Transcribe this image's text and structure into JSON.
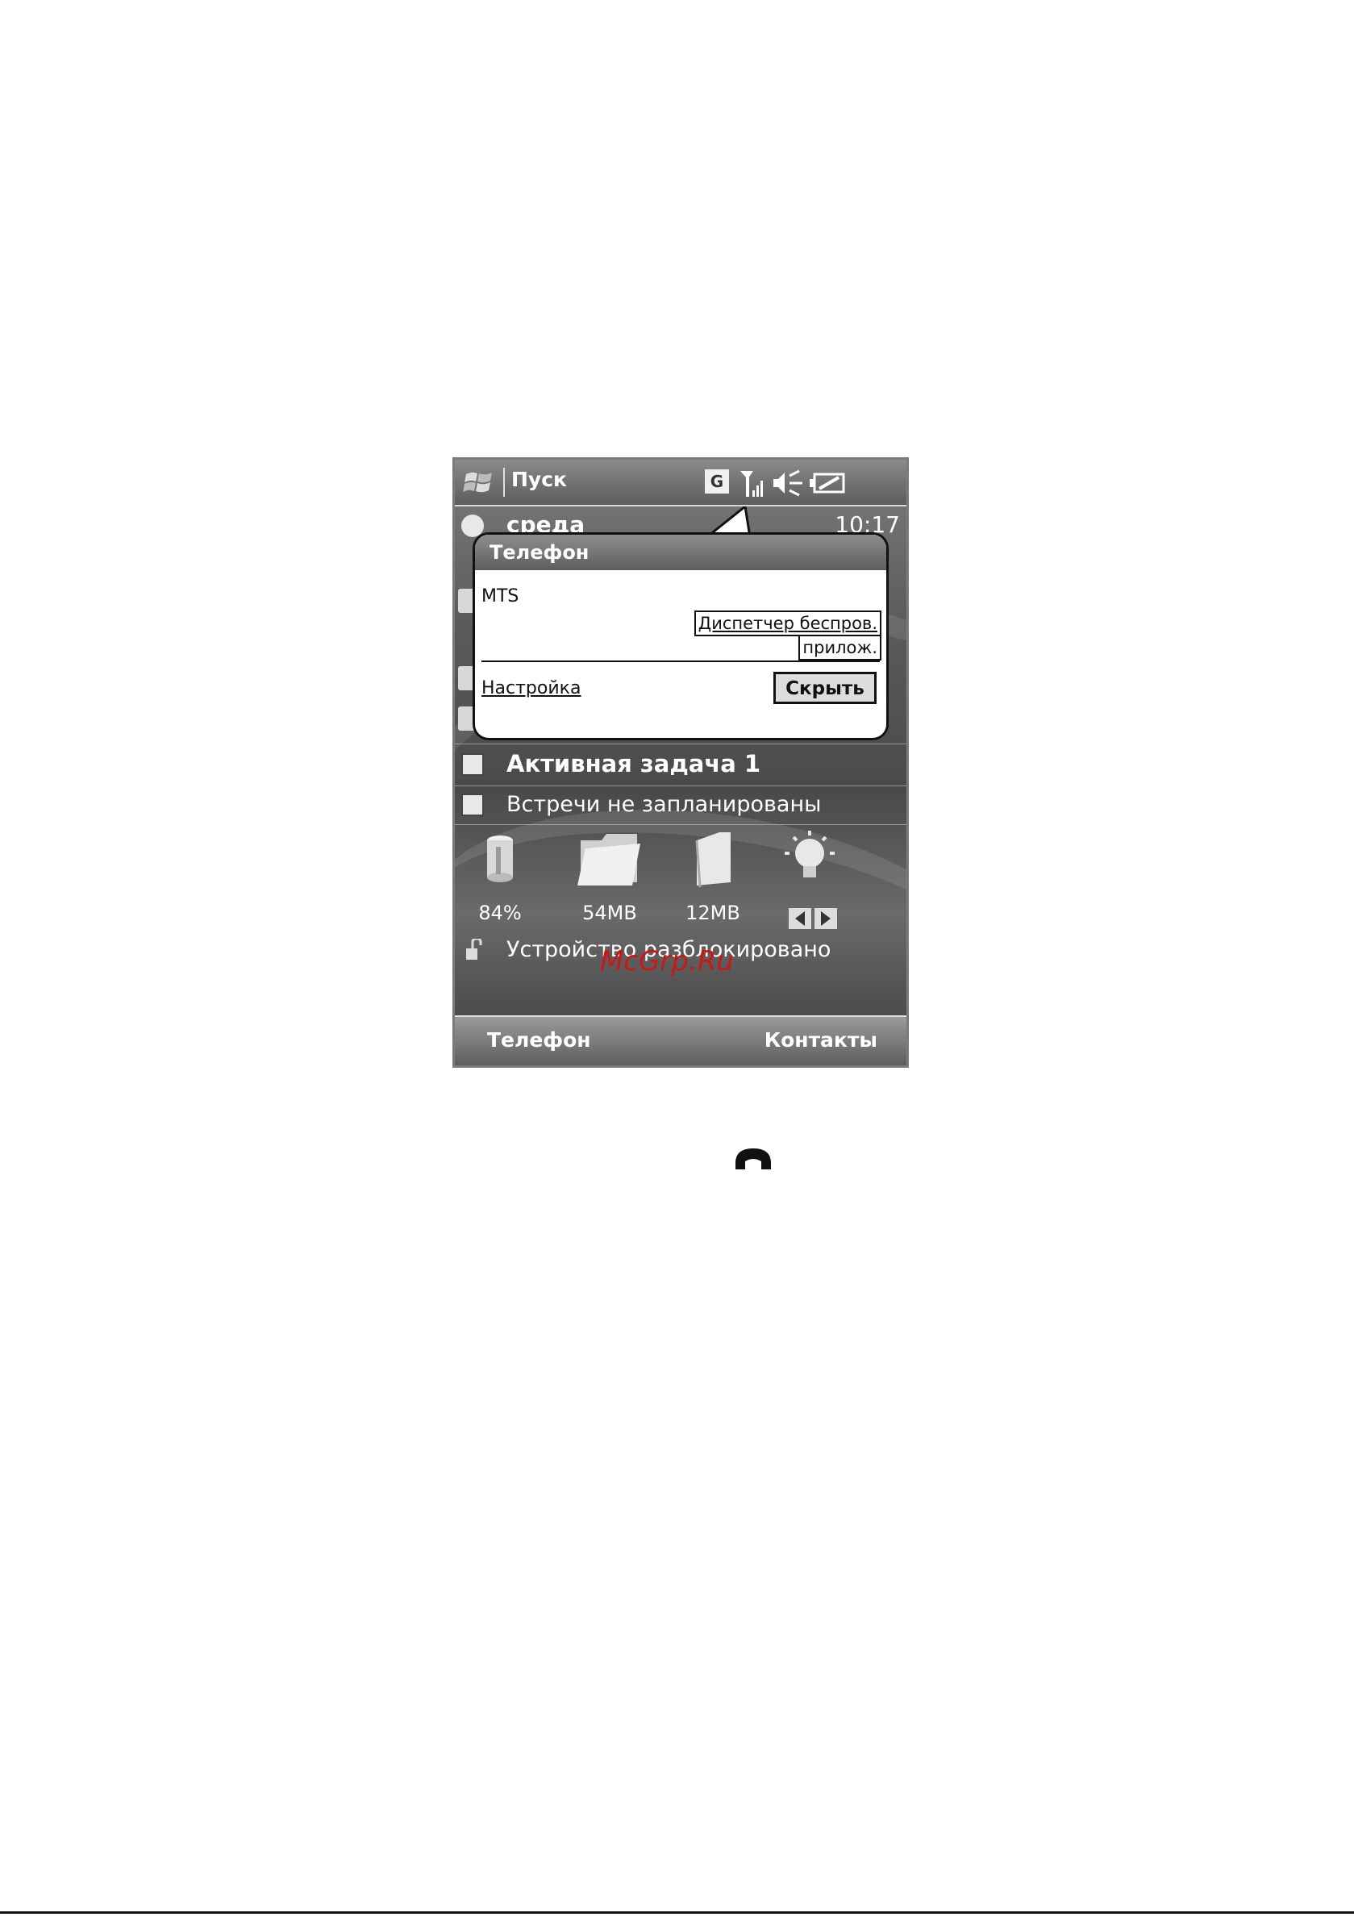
{
  "start_bar": {
    "start_label": "Пуск",
    "network_badge": "G",
    "icons": [
      "windows-flag-icon",
      "signal-icon",
      "volume-icon",
      "battery-icon"
    ]
  },
  "today": {
    "day": "среда",
    "time": "10:17",
    "active_task": "Активная задача 1",
    "appointments": "Встречи не запланированы",
    "lock_status": "Устройство разблокировано"
  },
  "popup": {
    "title": "Телефон",
    "operator": "MTS",
    "link_line1": "Диспетчер беспров.",
    "link_line2": "прилож.",
    "settings_link": "Настройка",
    "hide_button": "Скрыть"
  },
  "gadgets": {
    "battery": "84%",
    "storage": "54MB",
    "card": "12MB"
  },
  "softkeys": {
    "left": "Телефон",
    "right": "Контакты"
  },
  "watermark": "McGrp.Ru",
  "colors": {
    "watermark": "#c81818",
    "screen_bg": "#5a5a5a"
  }
}
